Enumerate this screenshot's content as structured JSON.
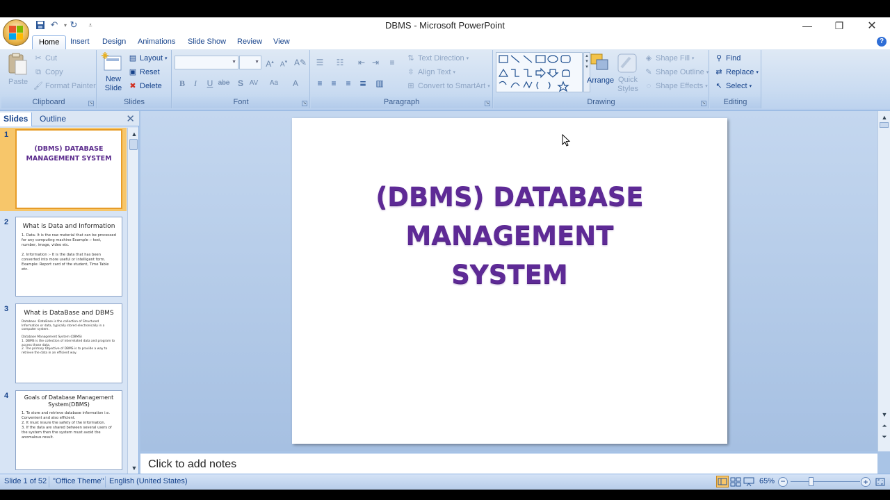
{
  "window": {
    "title": "DBMS - Microsoft PowerPoint",
    "controls": [
      "minimize",
      "restore",
      "close"
    ]
  },
  "qat": [
    "save-icon",
    "undo-icon",
    "redo-icon",
    "customize-icon"
  ],
  "tabs": [
    "Home",
    "Insert",
    "Design",
    "Animations",
    "Slide Show",
    "Review",
    "View"
  ],
  "active_tab": "Home",
  "ribbon": {
    "clipboard": {
      "label": "Clipboard",
      "paste": "Paste",
      "cut": "Cut",
      "copy": "Copy",
      "format_painter": "Format Painter"
    },
    "slides": {
      "label": "Slides",
      "new_slide": "New Slide",
      "layout": "Layout",
      "reset": "Reset",
      "delete": "Delete"
    },
    "font": {
      "label": "Font"
    },
    "paragraph": {
      "label": "Paragraph",
      "text_direction": "Text Direction",
      "align_text": "Align Text",
      "convert_smartart": "Convert to SmartArt"
    },
    "drawing": {
      "label": "Drawing",
      "arrange": "Arrange",
      "quick_styles": "Quick Styles",
      "shape_fill": "Shape Fill",
      "shape_outline": "Shape Outline",
      "shape_effects": "Shape Effects"
    },
    "editing": {
      "label": "Editing",
      "find": "Find",
      "replace": "Replace",
      "select": "Select"
    }
  },
  "pane": {
    "tab_slides": "Slides",
    "tab_outline": "Outline",
    "thumbnails": [
      {
        "num": "1",
        "title": "(DBMS) DATABASE MANAGEMENT SYSTEM",
        "body": ""
      },
      {
        "num": "2",
        "title": "What is Data and Information",
        "body": "1.  Data- It is the raw material that can be processed for any computing machine Example :- text, number, image, video etc.\n\n2. Information :- It is the data that has been converted into more useful or intelligent form. Example: Report card of the student, Time Table etc."
      },
      {
        "num": "3",
        "title": "What is DataBase and DBMS",
        "body": "Database :DataBase is the collection of Structured Information or data, typically stored electronically in a computer system.\n\nDatabase Management System (DBMS)\n1. DBMS is the collection of interrelated data and program to access those data.\n2. The primary Objective of DBMS is to provide a way to retrieve the data in an efficient way."
      },
      {
        "num": "4",
        "title": "Goals of Database Management System(DBMS)",
        "body": "1.   To store and retrieve database information i.e. Convenient and also efficient.\n2.   It must insure the safety of the information.\n3.   If the data are shared between several users of the system then the system must avoid the anomalous result."
      }
    ]
  },
  "slide": {
    "title_line1": "(DBMS) DATABASE",
    "title_line2": "MANAGEMENT",
    "title_line3": "SYSTEM"
  },
  "notes_placeholder": "Click to add notes",
  "status": {
    "slide_info": "Slide 1 of 52",
    "theme": "\"Office Theme\"",
    "language": "English (United States)",
    "zoom": "65%"
  }
}
